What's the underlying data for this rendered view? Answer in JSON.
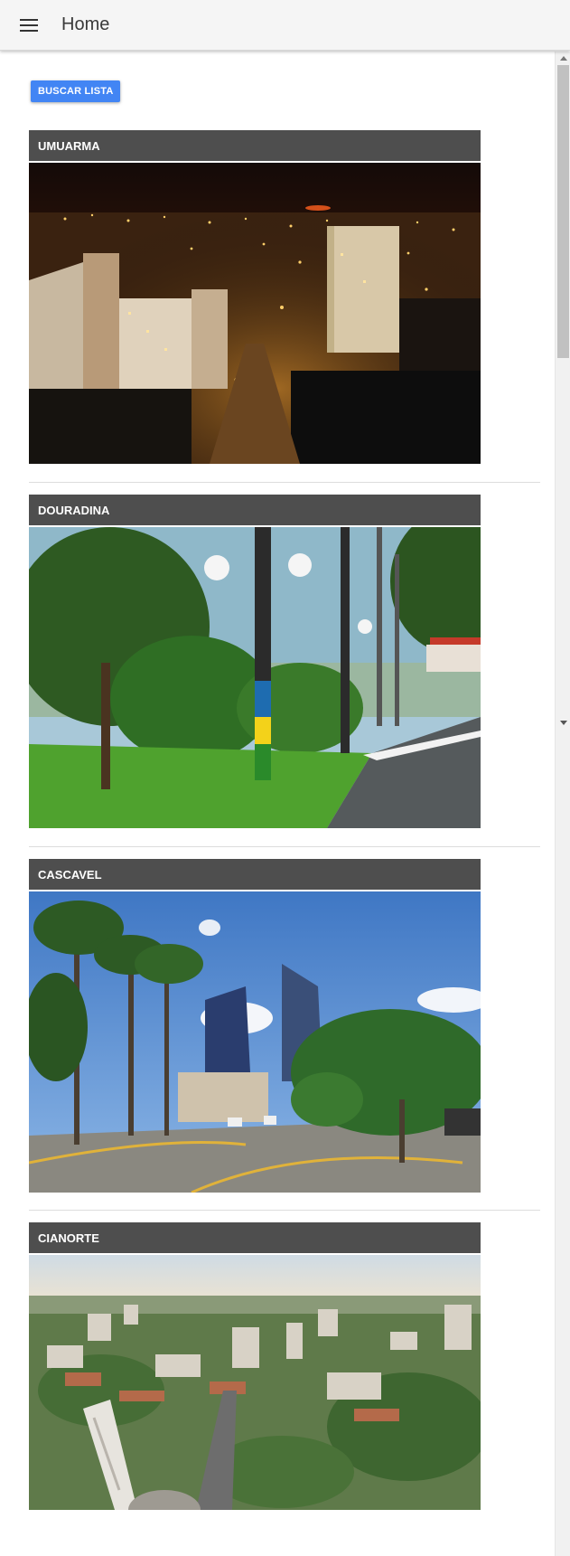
{
  "app": {
    "title": "Home"
  },
  "actions": {
    "buscar_label": "BUSCAR LISTA"
  },
  "cities": [
    {
      "name": "UMUARMA"
    },
    {
      "name": "DOURADINA"
    },
    {
      "name": "CASCAVEL"
    },
    {
      "name": "CIANORTE"
    }
  ],
  "icons": {
    "menu": "menu-icon",
    "scroll_up": "arrow-up-icon",
    "scroll_down": "arrow-down-icon"
  },
  "colors": {
    "primary_button": "#4285f4",
    "card_header": "#4e4e4e"
  }
}
